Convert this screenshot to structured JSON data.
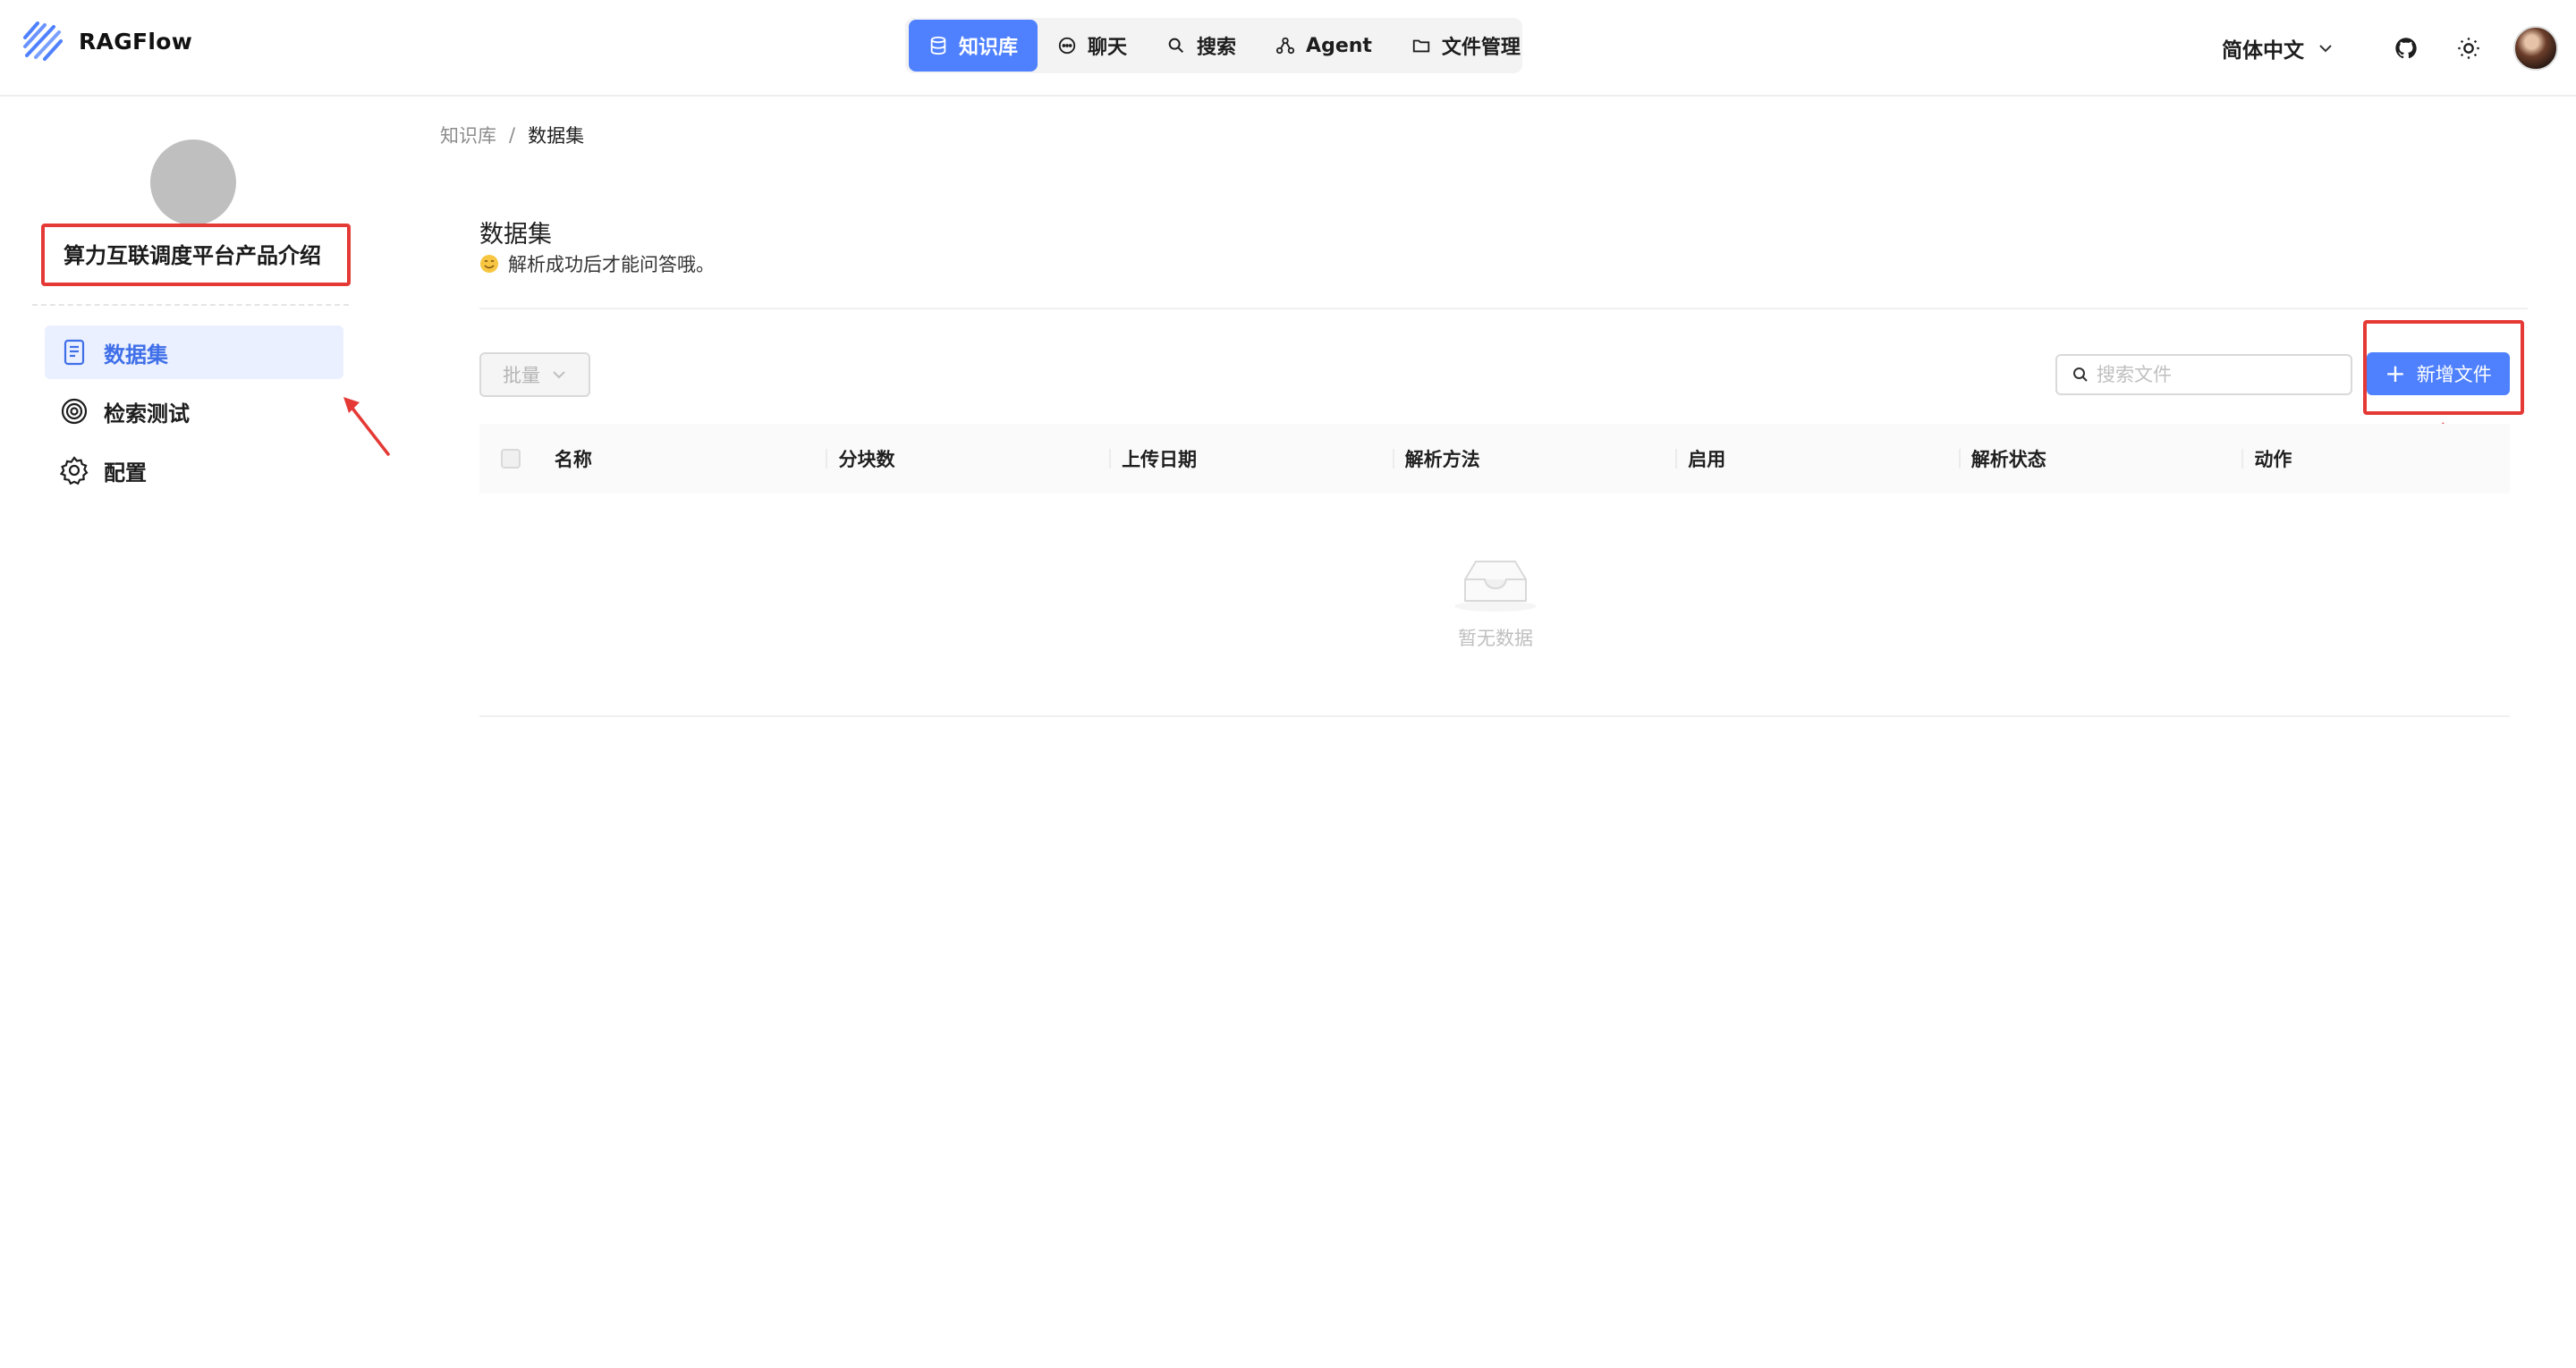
{
  "app": {
    "brand": "RAGFlow"
  },
  "nav": {
    "items": [
      {
        "label": "知识库",
        "icon": "database-icon",
        "active": true
      },
      {
        "label": "聊天",
        "icon": "chat-icon",
        "active": false
      },
      {
        "label": "搜索",
        "icon": "search-icon",
        "active": false
      },
      {
        "label": "Agent",
        "icon": "agent-graph-icon",
        "active": false
      },
      {
        "label": "文件管理",
        "icon": "folder-icon",
        "active": false
      }
    ]
  },
  "header_right": {
    "language": "简体中文",
    "github_icon": "github-icon",
    "theme_icon": "sun-icon"
  },
  "sidebar": {
    "kb_name": "算力互联调度平台产品介绍",
    "items": [
      {
        "label": "数据集",
        "icon": "document-icon",
        "active": true
      },
      {
        "label": "检索测试",
        "icon": "target-icon",
        "active": false
      },
      {
        "label": "配置",
        "icon": "gear-icon",
        "active": false
      }
    ]
  },
  "breadcrumb": {
    "root": "知识库",
    "separator": "/",
    "current": "数据集"
  },
  "main": {
    "title": "数据集",
    "subtitle": "解析成功后才能问答哦。",
    "batch_label": "批量",
    "search_placeholder": "搜索文件",
    "add_label": "新增文件",
    "columns": [
      "名称",
      "分块数",
      "上传日期",
      "解析方法",
      "启用",
      "解析状态",
      "动作"
    ],
    "empty_text": "暂无数据"
  },
  "colors": {
    "accent": "#4f81ff",
    "highlight": "#e53935"
  }
}
